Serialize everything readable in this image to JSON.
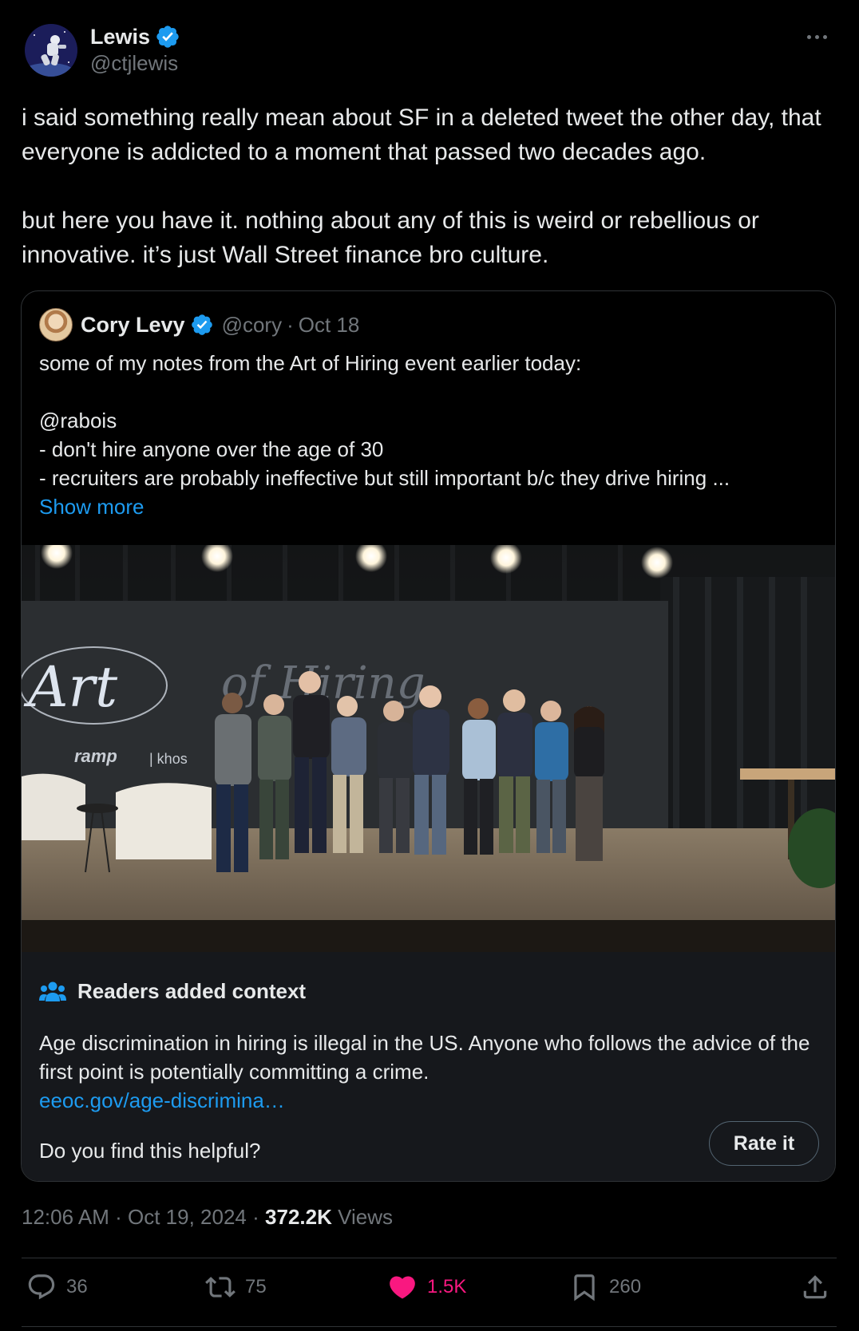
{
  "author": {
    "name": "Lewis",
    "handle": "@ctjlewis",
    "verified": true
  },
  "tweet": {
    "paragraphs": [
      "i said something really mean about SF in a deleted tweet the other day, that everyone is addicted to a moment that passed two decades ago.",
      "but here you have it. nothing about any of this is weird or rebellious or innovative. it’s just Wall Street finance bro culture."
    ]
  },
  "quote": {
    "name": "Cory Levy",
    "handle": "@cory",
    "separator": "·",
    "date": "Oct 18",
    "lines": [
      "some of my notes from the Art of Hiring event earlier today:",
      "@rabois",
      "- don't hire anyone over the age of 30",
      "- recruiters are probably ineffective but still important b/c they drive hiring ..."
    ],
    "show_more": "Show more",
    "image": {
      "banner_text_1": "Art",
      "banner_text_2": "of Hiring",
      "sponsor_text": "ramp",
      "sponsor_text_2": "| khos"
    }
  },
  "context": {
    "title": "Readers added context",
    "body": "Age discrimination in hiring is illegal in the US. Anyone who follows the advice of the first point is potentially committing a crime.",
    "link": "eeoc.gov/age-discrimina…",
    "question": "Do you find this helpful?",
    "rate_label": "Rate it"
  },
  "meta": {
    "time": "12:06 AM",
    "sep1": "·",
    "date": "Oct 19, 2024",
    "sep2": "·",
    "views_count": "372.2K",
    "views_label": "Views"
  },
  "actions": {
    "replies": "36",
    "reposts": "75",
    "likes": "1.5K",
    "bookmarks": "260"
  },
  "colors": {
    "background": "#000000",
    "accent": "#1d9bf0",
    "like": "#f91880",
    "muted": "#71767b",
    "text": "#e7e9ea"
  }
}
